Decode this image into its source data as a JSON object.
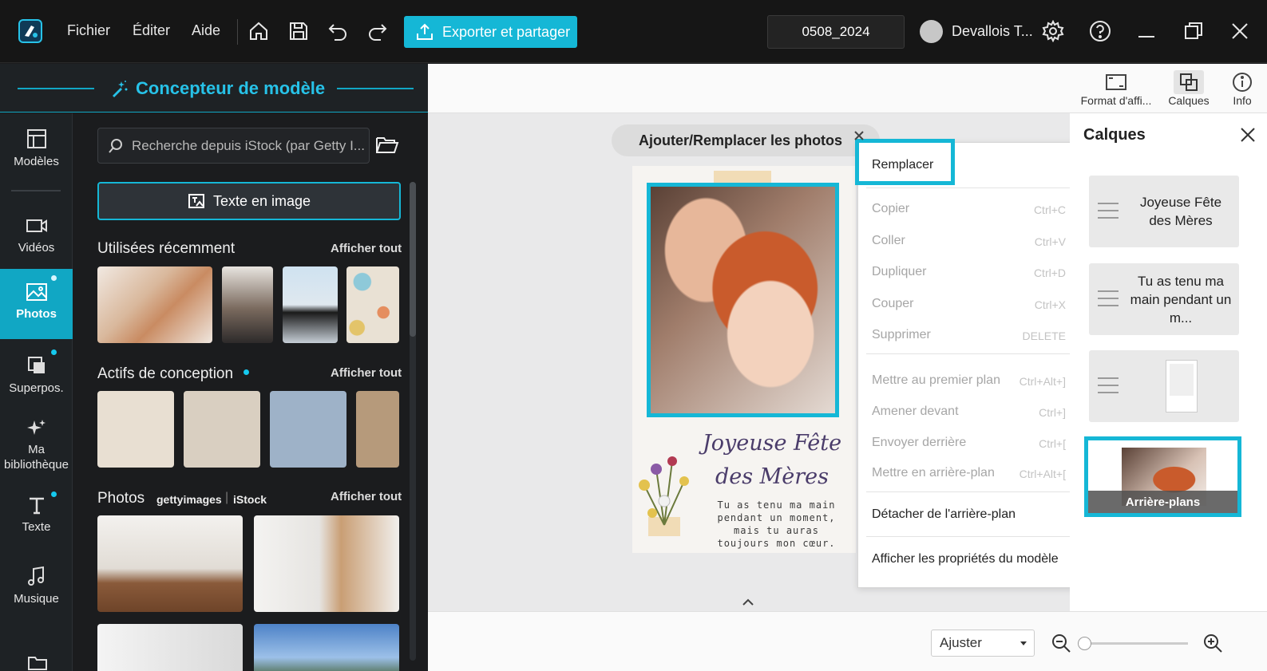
{
  "titlebar": {
    "menu": {
      "file": "Fichier",
      "edit": "Éditer",
      "help": "Aide"
    },
    "export_label": "Exporter et partager",
    "project_name": "0508_2024",
    "user_name": "Devallois T..."
  },
  "designer": {
    "title": "Concepteur de modèle"
  },
  "nav": {
    "templates": "Modèles",
    "videos": "Vidéos",
    "photos": "Photos",
    "overlays": "Superpos.",
    "library_line1": "Ma",
    "library_line2": "bibliothèque",
    "text": "Texte",
    "music": "Musique"
  },
  "panel": {
    "search_placeholder": "Recherche depuis iStock (par Getty I...",
    "text_to_image": "Texte en image",
    "recent_title": "Utilisées récemment",
    "design_assets_title": "Actifs de conception",
    "photos_title": "Photos",
    "getty_logo": "gettyimages",
    "istock_logo": "iStock",
    "see_all": "Afficher tout"
  },
  "top_tools": {
    "display_format": "Format d'affi...",
    "layers": "Calques",
    "info": "Info"
  },
  "canvas": {
    "replace_photos_pill": "Ajouter/Remplacer les photos",
    "card_title_line1": "Joyeuse Fête",
    "card_title_line2": "des Mères",
    "card_body": [
      "Tu as tenu ma main",
      "pendant un moment,",
      "mais tu auras",
      "toujours mon cœur."
    ]
  },
  "context_menu": {
    "replace": "Remplacer",
    "items": [
      {
        "label": "Copier",
        "shortcut": "Ctrl+C"
      },
      {
        "label": "Coller",
        "shortcut": "Ctrl+V"
      },
      {
        "label": "Dupliquer",
        "shortcut": "Ctrl+D"
      },
      {
        "label": "Couper",
        "shortcut": "Ctrl+X"
      },
      {
        "label": "Supprimer",
        "shortcut": "DELETE"
      }
    ],
    "order_items": [
      {
        "label": "Mettre au premier plan",
        "shortcut": "Ctrl+Alt+]"
      },
      {
        "label": "Amener devant",
        "shortcut": "Ctrl+]"
      },
      {
        "label": "Envoyer derrière",
        "shortcut": "Ctrl+["
      },
      {
        "label": "Mettre en arrière-plan",
        "shortcut": "Ctrl+Alt+["
      }
    ],
    "detach_background": "Détacher de l'arrière-plan",
    "show_template_properties": "Afficher les propriétés du modèle"
  },
  "layers": {
    "title": "Calques",
    "items": [
      {
        "label": "Joyeuse Fête des Mères"
      },
      {
        "label": "Tu as tenu ma main pendant un m..."
      },
      {
        "label": ""
      },
      {
        "label": "Arrière-plans"
      }
    ]
  },
  "bottom": {
    "fit_option": "Ajuster"
  },
  "colors": {
    "accent": "#15b7d6",
    "sidebar_bg": "#1e2225",
    "titlebar_bg": "#161616"
  }
}
